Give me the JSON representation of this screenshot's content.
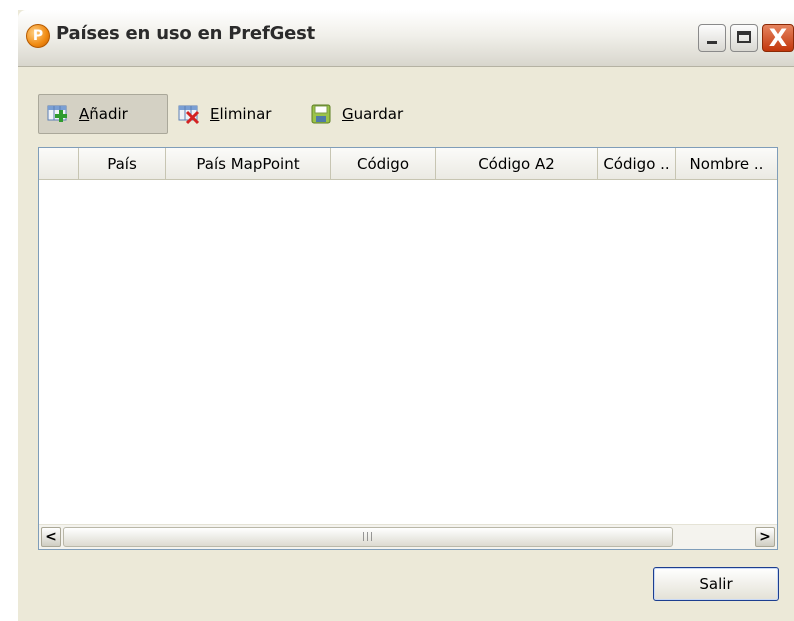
{
  "window": {
    "title": "Países en uso en PrefGest",
    "app_icon_letter": "P",
    "controls": {
      "close_glyph": "X"
    }
  },
  "toolbar": {
    "add": {
      "label_underlined": "A",
      "label_rest": "ñadir",
      "icon": "add-row-icon"
    },
    "delete": {
      "label_underlined": "E",
      "label_rest": "liminar",
      "icon": "delete-row-icon"
    },
    "save": {
      "label_underlined": "G",
      "label_rest": "uardar",
      "icon": "save-disk-icon"
    }
  },
  "grid": {
    "columns": [
      "",
      "País",
      "País MapPoint",
      "Código",
      "Código A2",
      "Código ..",
      "Nombre .."
    ],
    "rows": [],
    "scrollbar": {
      "left_arrow": "<",
      "right_arrow": ">",
      "grip": "|||"
    }
  },
  "footer": {
    "exit_label": "Salir"
  },
  "colors": {
    "grid_border": "#7f9db9",
    "window_bg": "#ece9d8",
    "close_red": "#c2360c"
  }
}
